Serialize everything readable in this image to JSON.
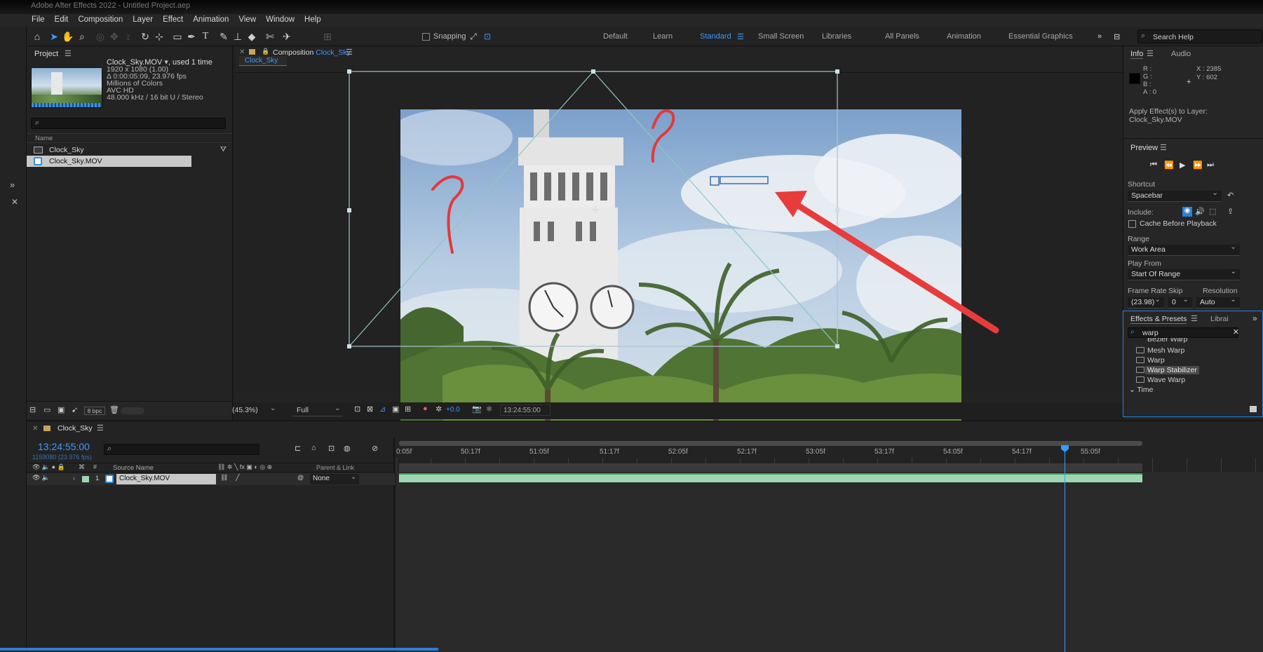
{
  "app": {
    "title": "Adobe After Effects 2022 - Untitled Project.aep"
  },
  "menu": [
    "File",
    "Edit",
    "Composition",
    "Layer",
    "Effect",
    "Animation",
    "View",
    "Window",
    "Help"
  ],
  "toolbar": {
    "snapping_label": "Snapping",
    "workspaces": [
      "Default",
      "Learn",
      "Standard",
      "Small Screen",
      "Libraries",
      "All Panels",
      "Animation",
      "Essential Graphics"
    ],
    "active_workspace": "Standard",
    "search_help": "Search Help"
  },
  "project": {
    "title": "Project",
    "footage_name": "Clock_Sky.MOV",
    "used_text": ", used 1 time",
    "meta": [
      "1920 x 1080 (1.00)",
      "Δ 0:00:05:09, 23.976 fps",
      "Millions of Colors",
      "AVC HD",
      "48.000 kHz / 16 bit U / Stereo"
    ],
    "search_placeholder": "",
    "col_name": "Name",
    "items": [
      "Clock_Sky",
      "Clock_Sky.MOV"
    ],
    "bpc": "8 bpc"
  },
  "composition": {
    "panel_label": "Composition",
    "comp_name": "Clock_Sky",
    "tab": "Clock_Sky",
    "zoom": "(45.3%)",
    "resolution": "Full",
    "exposure": "+0.0",
    "timecode": "13:24:55:00",
    "annotation_marks": [
      "?",
      "?"
    ]
  },
  "info": {
    "tab_info": "Info",
    "tab_audio": "Audio",
    "channels": [
      "R :",
      "G :",
      "B :",
      "A : 0"
    ],
    "x": "X : 2385",
    "y": "Y : 602",
    "message": "Apply Effect(s) to Layer:",
    "layer": "Clock_Sky.MOV"
  },
  "preview": {
    "title": "Preview",
    "shortcut_label": "Shortcut",
    "shortcut": "Spacebar",
    "include_label": "Include:",
    "cache_label": "Cache Before Playback",
    "range_label": "Range",
    "range": "Work Area",
    "play_from_label": "Play From",
    "play_from": "Start Of Range",
    "frame_rate_label": "Frame Rate",
    "skip_label": "Skip",
    "resolution_label": "Resolution",
    "frame_rate": "(23.98)",
    "skip": "0",
    "resolution": "Auto"
  },
  "effects": {
    "tab": "Effects & Presets",
    "tab2": "Librai",
    "search": "warp",
    "items": [
      "Bezier Warp",
      "Mesh Warp",
      "Warp",
      "Warp Stabilizer",
      "Wave Warp"
    ],
    "selected": "Warp Stabilizer",
    "group": "Time"
  },
  "timeline": {
    "comp_tab": "Clock_Sky",
    "timecode": "13:24:55:00",
    "frame_info": "1159080 (23.976 fps)",
    "col_source": "Source Name",
    "col_parent": "Parent & Link",
    "layer_num": "1",
    "layer_name": "Clock_Sky.MOV",
    "parent": "None",
    "ticks": [
      "0:05f",
      "50:17f",
      "51:05f",
      "51:17f",
      "52:05f",
      "52:17f",
      "53:05f",
      "53:17f",
      "54:05f",
      "54:17f",
      "55:05f"
    ],
    "playhead_fraction": 0.895
  },
  "colors": {
    "accent": "#3a9bff",
    "arrow": "#e03a3a",
    "track": "#9fd6b2"
  }
}
